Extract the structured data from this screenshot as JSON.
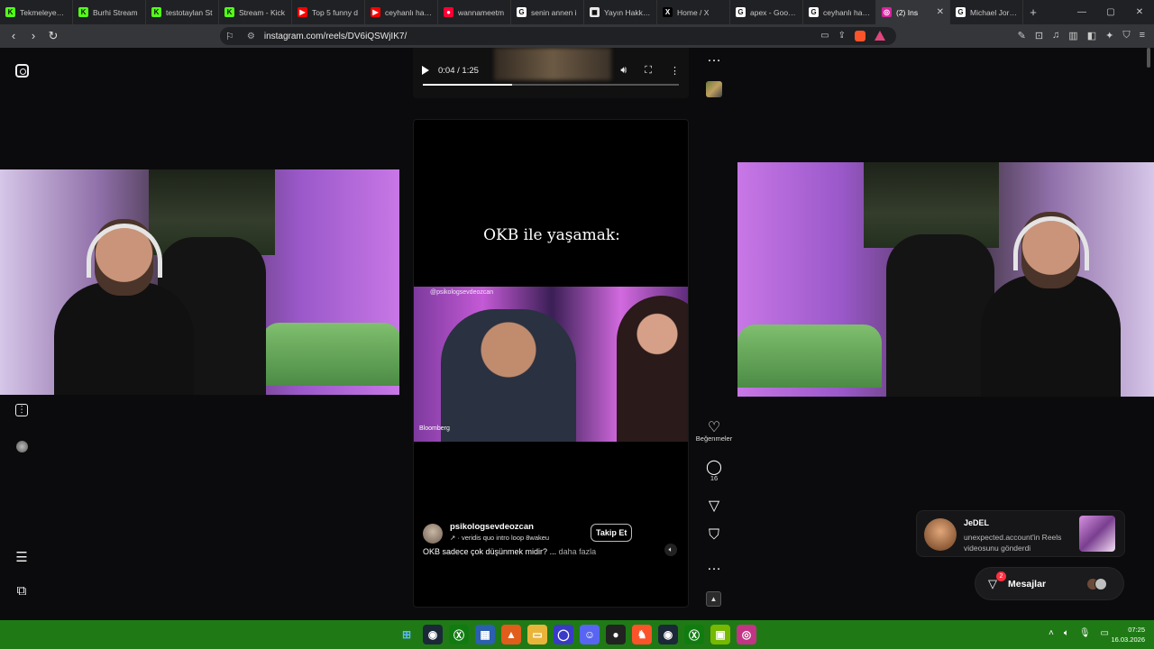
{
  "browser": {
    "tabs": [
      {
        "label": "TekmeleyeJan",
        "icon": "kick-icon",
        "color": "#53fc18",
        "glyph": "K"
      },
      {
        "label": "Burhi Stream",
        "icon": "kick-icon",
        "color": "#53fc18",
        "glyph": "K"
      },
      {
        "label": "testotaylan St",
        "icon": "kick-icon",
        "color": "#53fc18",
        "glyph": "K"
      },
      {
        "label": "Stream - Kick",
        "icon": "kick-icon",
        "color": "#53fc18",
        "glyph": "K"
      },
      {
        "label": "Top 5 funny d",
        "icon": "youtube-icon",
        "color": "#ff0000",
        "glyph": "▶"
      },
      {
        "label": "ceyhanlı haka",
        "icon": "youtube-icon",
        "color": "#ff0000",
        "glyph": "▶"
      },
      {
        "label": "wannameetm",
        "icon": "youtube-music-icon",
        "color": "#ff0033",
        "glyph": "●"
      },
      {
        "label": "senin annen i",
        "icon": "google-icon",
        "color": "#ffffff",
        "glyph": "G"
      },
      {
        "label": "Yayın Hakkını",
        "icon": "page-icon",
        "color": "#e8e8e8",
        "glyph": "◼"
      },
      {
        "label": "Home / X",
        "icon": "x-icon",
        "color": "#000000",
        "glyph": "X"
      },
      {
        "label": "apex - Google",
        "icon": "google-icon",
        "color": "#ffffff",
        "glyph": "G"
      },
      {
        "label": "ceyhanlı haka",
        "icon": "google-icon",
        "color": "#ffffff",
        "glyph": "G"
      },
      {
        "label": "(2) Ins",
        "icon": "instagram-icon",
        "color": "#d6249f",
        "glyph": "◎",
        "active": true
      },
      {
        "label": "Michael Jorda",
        "icon": "google-icon",
        "color": "#ffffff",
        "glyph": "G"
      }
    ],
    "url": "instagram.com/reels/DV6iQSWjIK7/"
  },
  "video": {
    "time": "0:04 / 1:25",
    "progress": 0.35
  },
  "reel": {
    "title": "OKB ile yaşamak:",
    "clip_handle": "@psikologsevdeozcan",
    "clip_logo": "Bloomberg",
    "author": "psikologsevdeozcan",
    "music": "↗  · veridis quo intro loop    8wakeu",
    "follow_label": "Takip Et",
    "caption": "OKB sadece çok düşünmek midir? ...",
    "caption_more": "daha fazla"
  },
  "actions": {
    "likes_label": "Beğenmeler",
    "comments_count": "16"
  },
  "notification": {
    "sender": "JeDEL",
    "message": "unexpected.account'in Reels videosunu gönderdi"
  },
  "messages": {
    "label": "Mesajlar",
    "badge": "2"
  },
  "taskbar": {
    "time": "07:25",
    "date": "16.03.2026"
  },
  "colors": {
    "accent_purple": "#c45ad6",
    "taskbar_green": "#1f7a16",
    "badge_red": "#ff3040"
  }
}
